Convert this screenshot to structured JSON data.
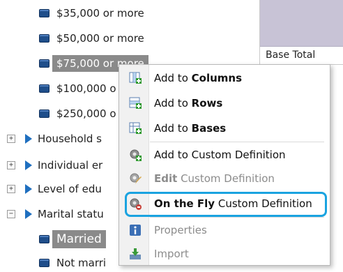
{
  "tree": {
    "items": [
      {
        "kind": "leaf",
        "label": "$35,000 or more"
      },
      {
        "kind": "leaf",
        "label": "$50,000 or more"
      },
      {
        "kind": "leaf",
        "label": "$75,000 or more",
        "selected": true
      },
      {
        "kind": "leaf",
        "label": "$100,000 o"
      },
      {
        "kind": "leaf",
        "label": "$250,000 o"
      },
      {
        "kind": "folder",
        "label": "Household s",
        "expander": "+"
      },
      {
        "kind": "folder",
        "label": "Individual er",
        "expander": "+"
      },
      {
        "kind": "folder",
        "label": "Level of edu",
        "expander": "+"
      },
      {
        "kind": "folder",
        "label": "Marital statu",
        "expander": "−"
      },
      {
        "kind": "leaf",
        "label": "Married",
        "selected": true
      },
      {
        "kind": "leaf",
        "label": "Not marri"
      }
    ]
  },
  "grid": {
    "cell_label": "Base Total",
    "header_color": "#c8c3d6"
  },
  "context_menu": {
    "items": [
      {
        "prefix": "Add to ",
        "bold": "Columns",
        "suffix": "",
        "icon": "add-columns-icon",
        "enabled": true
      },
      {
        "prefix": "Add to ",
        "bold": "Rows",
        "suffix": "",
        "icon": "add-rows-icon",
        "enabled": true
      },
      {
        "prefix": "Add to ",
        "bold": "Bases",
        "suffix": "",
        "icon": "add-bases-icon",
        "enabled": true
      },
      {
        "prefix": "Add to Custom Definition",
        "bold": "",
        "suffix": "",
        "icon": "gear-add-icon",
        "enabled": true
      },
      {
        "prefix": "",
        "bold": "Edit",
        "suffix": " Custom Definition",
        "icon": "gear-edit-icon",
        "enabled": false
      },
      {
        "prefix": "",
        "bold": "On the Fly",
        "suffix": " Custom Definition",
        "icon": "gear-fly-icon",
        "enabled": true,
        "highlighted": true
      },
      {
        "prefix": "Properties",
        "bold": "",
        "suffix": "",
        "icon": "info-icon",
        "enabled": false
      },
      {
        "prefix": "Import",
        "bold": "",
        "suffix": "",
        "icon": "import-icon",
        "enabled": false
      }
    ]
  },
  "colors": {
    "highlight_ring": "#1aa3e0",
    "selection": "#8a8a8a",
    "accent_blue": "#1f6fbf"
  }
}
